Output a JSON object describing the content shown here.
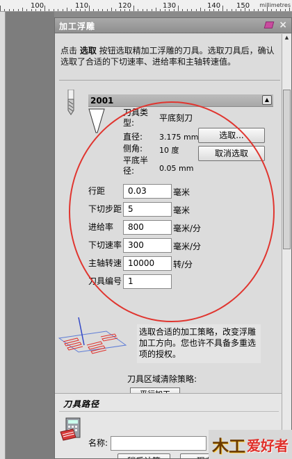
{
  "ruler": {
    "labels": [
      "100",
      "110",
      "120",
      "130",
      "140",
      "150"
    ],
    "unit": "millimetres"
  },
  "panel": {
    "title": "加工浮雕"
  },
  "intro": {
    "part1": "点击 ",
    "button_name": "选取",
    "part2": " 按钮选取精加工浮雕的刀具。选取刀具后，确认选取了合适的下切速率、进给率和主轴转速值。"
  },
  "tool": {
    "id": "2001",
    "type_label": "刀具类型:",
    "type_value": "平底刻刀",
    "diameter_label": "直径:",
    "diameter_value": "3.175 mm",
    "side_angle_label": "侧角:",
    "side_angle_value": "10 度",
    "flat_radius_label": "平底半径:",
    "flat_radius_value": "0.05 mm",
    "select_button": "选取...",
    "deselect_button": "取消选取"
  },
  "params": [
    {
      "label": "行距",
      "value": "0.03",
      "unit": "毫米"
    },
    {
      "label": "下切步距",
      "value": "5",
      "unit": "毫米"
    },
    {
      "label": "进给率",
      "value": "800",
      "unit": "毫米/分"
    },
    {
      "label": "下切速率",
      "value": "300",
      "unit": "毫米/分"
    },
    {
      "label": "主轴转速",
      "value": "10000",
      "unit": "转/分"
    },
    {
      "label": "刀具编号",
      "value": "1",
      "unit": ""
    }
  ],
  "strategy": {
    "description": "选取合适的加工策略，改变浮雕加工方向。您也许不具备多重选项的授权。",
    "clear_label": "刀具区域清除策略:",
    "partial_button": "平行加工"
  },
  "toolpath": {
    "header": "刀具路径",
    "name_label": "名称:",
    "name_value": "",
    "calc_later_button": "稍后计算",
    "calc_now_button": "现在计算"
  },
  "watermark": {
    "part1": "木工",
    "part2": "爱好者"
  },
  "colors": {
    "annotation_circle": "#e0352f",
    "titlebar": "#9a9a9a",
    "panel_bg": "#dcdcdc"
  }
}
